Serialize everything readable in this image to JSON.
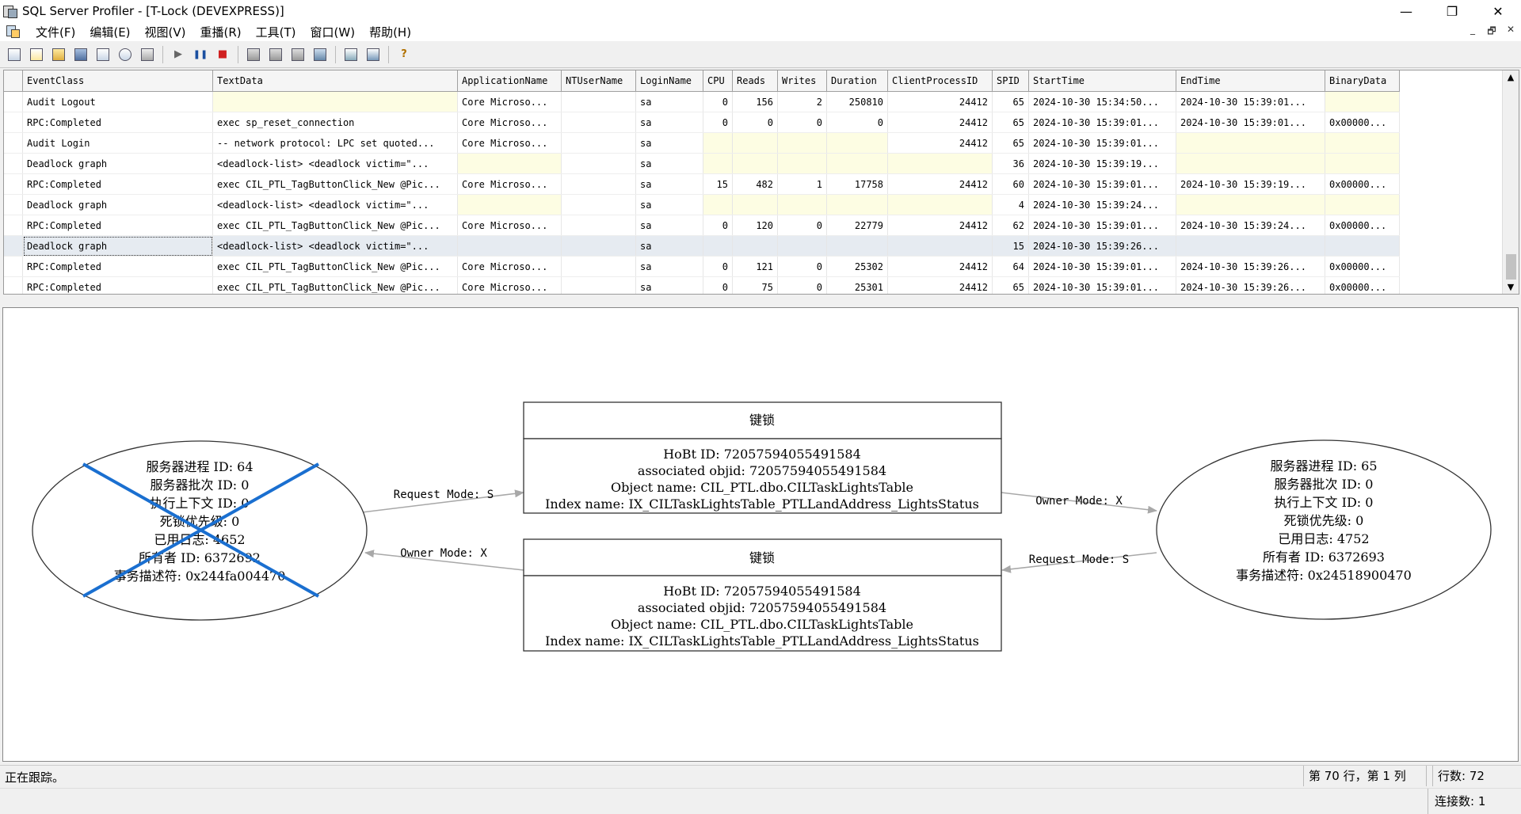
{
  "window": {
    "title": "SQL Server Profiler - [T-Lock (DEVEXPRESS)]",
    "controls": {
      "minimize": "—",
      "restore": "❐",
      "close": "✕"
    }
  },
  "menu": {
    "items": [
      "文件(F)",
      "编辑(E)",
      "视图(V)",
      "重播(R)",
      "工具(T)",
      "窗口(W)",
      "帮助(H)"
    ],
    "mdi_controls": [
      "_",
      "🗗",
      "✕"
    ]
  },
  "toolbar": {
    "buttons": [
      "new-trace-icon",
      "new-template-icon",
      "open-icon",
      "save-icon",
      "properties-icon",
      "find-icon",
      "clear-icon",
      "run-icon",
      "pause-icon",
      "stop-icon",
      "events-icon",
      "columns-icon",
      "filter-icon",
      "autoscroll-icon",
      "perfmon-icon",
      "chart-icon",
      "help-icon"
    ],
    "run_glyph": "▶",
    "pause_glyph": "❚❚",
    "stop_glyph": "■",
    "help_glyph": "?"
  },
  "grid": {
    "columns": [
      "EventClass",
      "TextData",
      "ApplicationName",
      "NTUserName",
      "LoginName",
      "CPU",
      "Reads",
      "Writes",
      "Duration",
      "ClientProcessID",
      "SPID",
      "StartTime",
      "EndTime",
      "BinaryData"
    ],
    "rows": [
      [
        "Audit Logout",
        "",
        "Core Microso...",
        "",
        "sa",
        "0",
        "156",
        "2",
        "250810",
        "24412",
        "65",
        "2024-10-30 15:34:50...",
        "2024-10-30 15:39:01...",
        ""
      ],
      [
        "RPC:Completed",
        "exec sp_reset_connection",
        "Core Microso...",
        "",
        "sa",
        "0",
        "0",
        "0",
        "0",
        "24412",
        "65",
        "2024-10-30 15:39:01...",
        "2024-10-30 15:39:01...",
        "0x00000..."
      ],
      [
        "Audit Login",
        "-- network protocol: LPC  set quoted...",
        "Core Microso...",
        "",
        "sa",
        "",
        "",
        "",
        "",
        "24412",
        "65",
        "2024-10-30 15:39:01...",
        "",
        ""
      ],
      [
        "Deadlock graph",
        "<deadlock-list>  <deadlock victim=\"...",
        "",
        "",
        "sa",
        "",
        "",
        "",
        "",
        "",
        "36",
        "2024-10-30 15:39:19...",
        "",
        ""
      ],
      [
        "RPC:Completed",
        "exec CIL_PTL_TagButtonClick_New @Pic...",
        "Core Microso...",
        "",
        "sa",
        "15",
        "482",
        "1",
        "17758",
        "24412",
        "60",
        "2024-10-30 15:39:01...",
        "2024-10-30 15:39:19...",
        "0x00000..."
      ],
      [
        "Deadlock graph",
        "<deadlock-list>  <deadlock victim=\"...",
        "",
        "",
        "sa",
        "",
        "",
        "",
        "",
        "",
        "4",
        "2024-10-30 15:39:24...",
        "",
        ""
      ],
      [
        "RPC:Completed",
        "exec CIL_PTL_TagButtonClick_New @Pic...",
        "Core Microso...",
        "",
        "sa",
        "0",
        "120",
        "0",
        "22779",
        "24412",
        "62",
        "2024-10-30 15:39:01...",
        "2024-10-30 15:39:24...",
        "0x00000..."
      ],
      [
        "Deadlock graph",
        "<deadlock-list>  <deadlock victim=\"...",
        "",
        "",
        "sa",
        "",
        "",
        "",
        "",
        "",
        "15",
        "2024-10-30 15:39:26...",
        "",
        ""
      ],
      [
        "RPC:Completed",
        "exec CIL_PTL_TagButtonClick_New @Pic...",
        "Core Microso...",
        "",
        "sa",
        "0",
        "121",
        "0",
        "25302",
        "24412",
        "64",
        "2024-10-30 15:39:01...",
        "2024-10-30 15:39:26...",
        "0x00000..."
      ],
      [
        "RPC:Completed",
        "exec CIL_PTL_TagButtonClick_New @Pic...",
        "Core Microso...",
        "",
        "sa",
        "0",
        "75",
        "0",
        "25301",
        "24412",
        "65",
        "2024-10-30 15:39:01...",
        "2024-10-30 15:39:26...",
        "0x00000..."
      ]
    ],
    "selected_row": 7,
    "scroll_up": "▲",
    "scroll_down": "▼"
  },
  "graph": {
    "victim_process": {
      "lines": [
        "服务器进程 ID: 64",
        "服务器批次 ID: 0",
        "执行上下文 ID: 0",
        "死锁优先级: 0",
        "已用日志: 4652",
        "所有者 ID: 6372692",
        "事务描述符: 0x244fa004470"
      ],
      "victim_mark_color": "#1a6fd0"
    },
    "other_process": {
      "lines": [
        "服务器进程 ID: 65",
        "服务器批次 ID: 0",
        "执行上下文 ID: 0",
        "死锁优先级: 0",
        "已用日志: 4752",
        "所有者 ID: 6372693",
        "事务描述符: 0x24518900470"
      ]
    },
    "resource_top": {
      "header": "键锁",
      "lines": [
        "HoBt ID: 72057594055491584",
        "associated objid: 72057594055491584",
        "Object name: CIL_PTL.dbo.CILTaskLightsTable",
        "Index name: IX_CILTaskLightsTable_PTLLandAddress_LightsStatus"
      ]
    },
    "resource_bottom": {
      "header": "键锁",
      "lines": [
        "HoBt ID: 72057594055491584",
        "associated objid: 72057594055491584",
        "Object name: CIL_PTL.dbo.CILTaskLightsTable",
        "Index name: IX_CILTaskLightsTable_PTLLandAddress_LightsStatus"
      ]
    },
    "edges": {
      "left_top": "Request Mode: S",
      "left_bottom": "Owner Mode: X",
      "right_top": "Owner Mode: X",
      "right_bottom": "Request Mode: S"
    }
  },
  "status": {
    "message": "正在跟踪。",
    "position": "第 70 行，第 1 列",
    "row_count": "行数: 72",
    "connections": "连接数: 1"
  }
}
